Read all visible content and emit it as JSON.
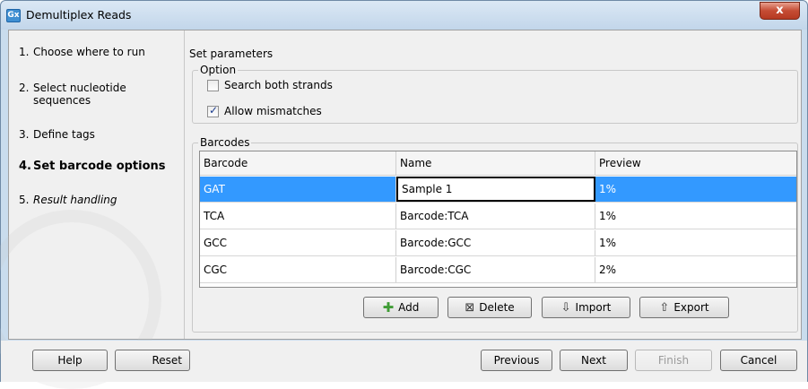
{
  "window": {
    "title": "Demultiplex Reads",
    "app_icon": "Gx",
    "close_glyph": "x"
  },
  "steps": [
    {
      "num": "1.",
      "label": "Choose where to run"
    },
    {
      "num": "2.",
      "label": "Select nucleotide sequences"
    },
    {
      "num": "3.",
      "label": "Define tags"
    },
    {
      "num": "4.",
      "label": "Set barcode options"
    },
    {
      "num": "5.",
      "label": "Result handling"
    }
  ],
  "content": {
    "heading": "Set parameters",
    "option_group": {
      "label": "Option",
      "search_both_strands": {
        "label": "Search both strands",
        "checked": false
      },
      "allow_mismatches": {
        "label": "Allow mismatches",
        "checked": true
      }
    },
    "barcodes_group": {
      "label": "Barcodes",
      "columns": [
        "Barcode",
        "Name",
        "Preview"
      ],
      "rows": [
        {
          "barcode": "GAT",
          "name": "Sample 1",
          "preview": "1%",
          "selected": true
        },
        {
          "barcode": "TCA",
          "name": "Barcode:TCA",
          "preview": "1%"
        },
        {
          "barcode": "GCC",
          "name": "Barcode:GCC",
          "preview": "1%"
        },
        {
          "barcode": "CGC",
          "name": "Barcode:CGC",
          "preview": "2%"
        }
      ],
      "buttons": {
        "add": "Add",
        "delete": "Delete",
        "import": "Import",
        "export": "Export"
      }
    }
  },
  "footer": {
    "help": "Help",
    "reset": "Reset",
    "previous": "Previous",
    "next": "Next",
    "finish": "Finish",
    "cancel": "Cancel"
  },
  "colors": {
    "selection": "#3399ff",
    "titlebar": "#c9dced",
    "close": "#c54c34"
  }
}
